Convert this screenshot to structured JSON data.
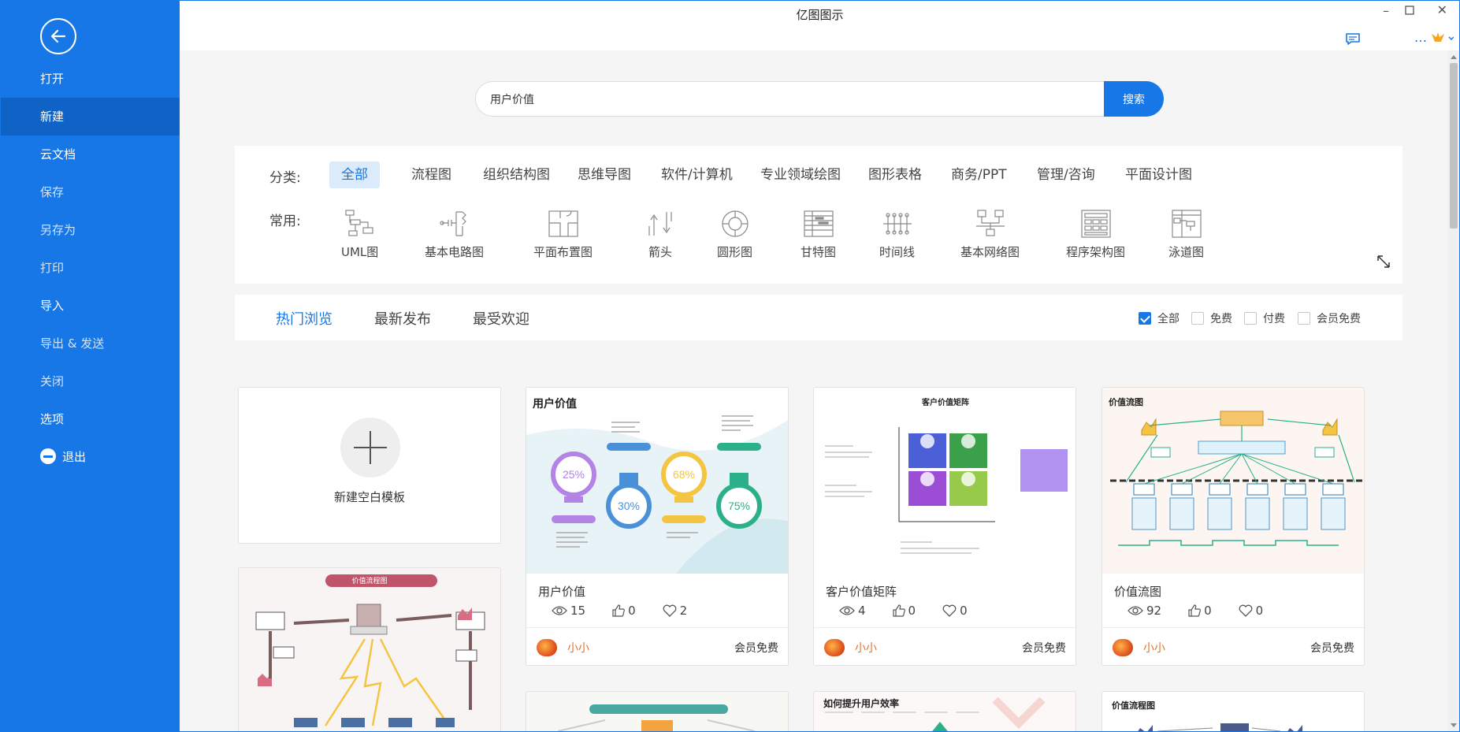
{
  "app": {
    "title": "亿图图示"
  },
  "sidebar": {
    "items": [
      {
        "label": "打开"
      },
      {
        "label": "新建"
      },
      {
        "label": "云文档"
      },
      {
        "label": "保存"
      },
      {
        "label": "另存为"
      },
      {
        "label": "打印"
      },
      {
        "label": "导入"
      },
      {
        "label": "导出 & 发送"
      },
      {
        "label": "关闭"
      },
      {
        "label": "选项"
      },
      {
        "label": "退出"
      }
    ]
  },
  "search": {
    "value": "用户价值",
    "button": "搜索"
  },
  "categories": {
    "label": "分类:",
    "items": [
      "全部",
      "流程图",
      "组织结构图",
      "思维导图",
      "软件/计算机",
      "专业领域绘图",
      "图形表格",
      "商务/PPT",
      "管理/咨询",
      "平面设计图"
    ],
    "active": "全部"
  },
  "common": {
    "label": "常用:",
    "items": [
      "UML图",
      "基本电路图",
      "平面布置图",
      "箭头",
      "圆形图",
      "甘特图",
      "时间线",
      "基本网络图",
      "程序架构图",
      "泳道图"
    ]
  },
  "tabs": {
    "items": [
      "热门浏览",
      "最新发布",
      "最受欢迎"
    ],
    "active": "热门浏览"
  },
  "filters": [
    {
      "label": "全部",
      "checked": true
    },
    {
      "label": "免费",
      "checked": false
    },
    {
      "label": "付费",
      "checked": false
    },
    {
      "label": "会员免费",
      "checked": false
    }
  ],
  "new_template": {
    "label": "新建空白模板"
  },
  "cards": [
    {
      "title": "用户价值",
      "views": "15",
      "likes": "0",
      "favorites": "2",
      "author": "小小",
      "price": "会员免费",
      "thumb": {
        "heading": "用户价值",
        "percents": [
          "25%",
          "30%",
          "68%",
          "75%"
        ]
      }
    },
    {
      "title": "客户价值矩阵",
      "views": "4",
      "likes": "0",
      "favorites": "0",
      "author": "小小",
      "price": "会员免费",
      "thumb": {
        "heading": "客户价值矩阵"
      }
    },
    {
      "title": "价值流图",
      "views": "92",
      "likes": "0",
      "favorites": "0",
      "author": "小小",
      "price": "会员免费",
      "thumb": {
        "heading": "价值流图"
      }
    }
  ],
  "partial_cards": [
    {
      "heading": "价值流程图"
    },
    {
      "heading": ""
    },
    {
      "heading": "如何提升用户效率"
    },
    {
      "heading": "价值流程图"
    }
  ],
  "colors": {
    "accent": "#1777e6",
    "sidebar": "#1777e6",
    "sidebar_active": "#0f63c6",
    "author": "#e2712a"
  }
}
